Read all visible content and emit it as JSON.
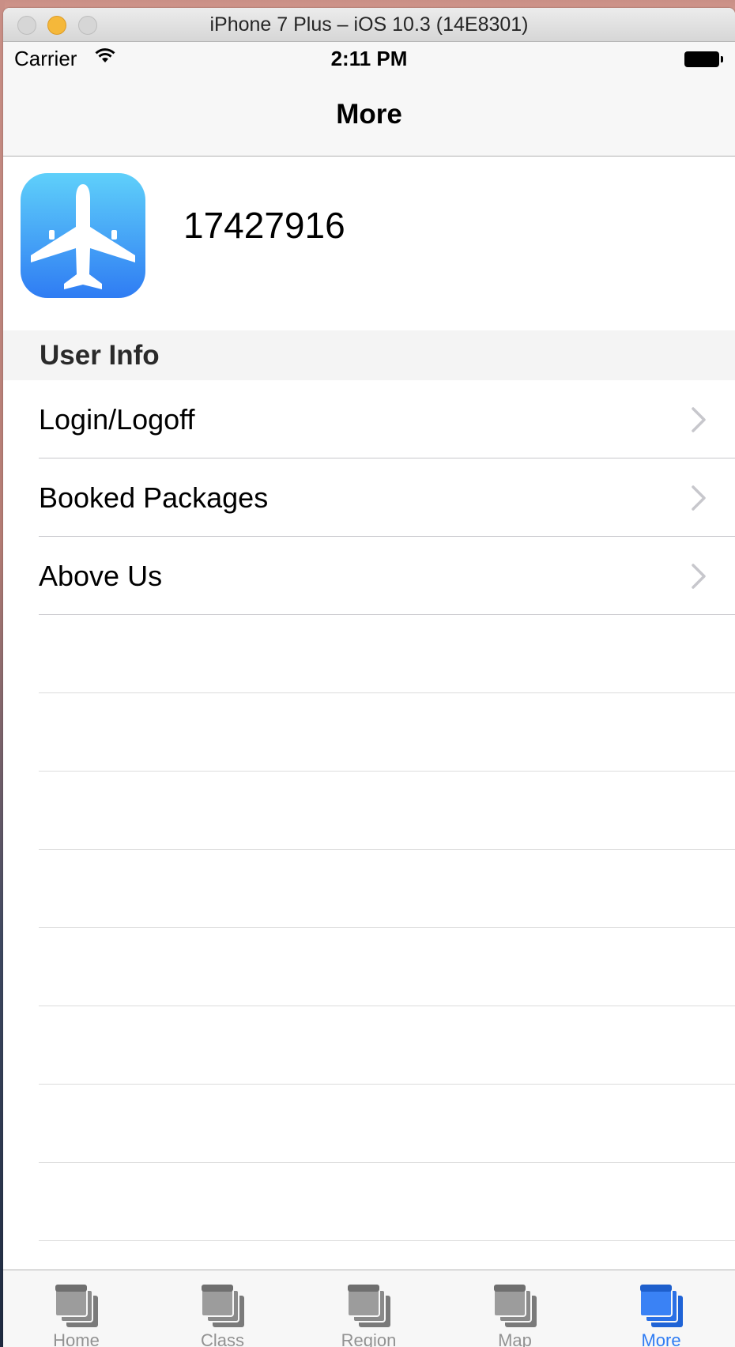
{
  "window": {
    "title": "iPhone 7 Plus – iOS 10.3 (14E8301)"
  },
  "status_bar": {
    "carrier": "Carrier",
    "time": "2:11 PM"
  },
  "nav": {
    "title": "More"
  },
  "profile": {
    "account_id": "17427916",
    "icon": "airplane-icon"
  },
  "section": {
    "title": "User Info"
  },
  "rows": [
    {
      "label": "Login/Logoff"
    },
    {
      "label": "Booked Packages"
    },
    {
      "label": "Above Us"
    }
  ],
  "tabs": [
    {
      "label": "Home",
      "active": false
    },
    {
      "label": "Class",
      "active": false
    },
    {
      "label": "Region",
      "active": false
    },
    {
      "label": "Map",
      "active": false
    },
    {
      "label": "More",
      "active": true
    }
  ],
  "colors": {
    "accent": "#2f7cf3",
    "inactive": "#929292"
  }
}
